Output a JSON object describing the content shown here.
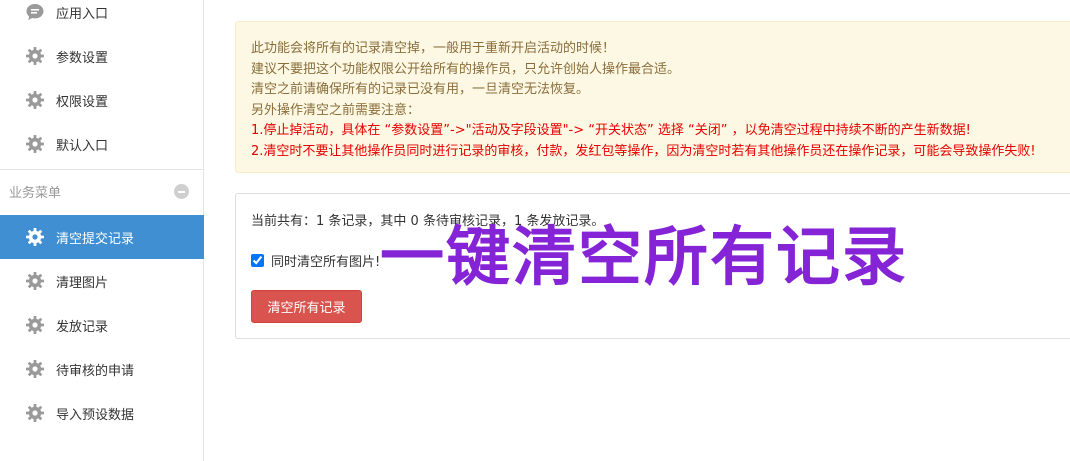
{
  "sidebar": {
    "items": [
      {
        "label": "应用入口",
        "icon": "chat-bubble-icon"
      },
      {
        "label": "参数设置",
        "icon": "gear-icon"
      },
      {
        "label": "权限设置",
        "icon": "gear-icon"
      },
      {
        "label": "默认入口",
        "icon": "gear-icon"
      }
    ],
    "section_label": "业务菜单",
    "business_items": [
      {
        "label": "清空提交记录",
        "icon": "gear-icon",
        "active": true
      },
      {
        "label": "清理图片",
        "icon": "gear-icon"
      },
      {
        "label": "发放记录",
        "icon": "gear-icon"
      },
      {
        "label": "待审核的申请",
        "icon": "gear-icon"
      },
      {
        "label": "导入预设数据",
        "icon": "gear-icon"
      }
    ]
  },
  "notice": {
    "lines": [
      "此功能会将所有的记录清空掉，一般用于重新开启活动的时候！",
      "建议不要把这个功能权限公开给所有的操作员，只允许创始人操作最合适。",
      "清空之前请确保所有的记录已没有用，一旦清空无法恢复。",
      "另外操作清空之前需要注意："
    ],
    "warnings": [
      "1.停止掉活动，具体在 “参数设置”->\"活动及字段设置\"-> “开关状态” 选择 “关闭” ，以免清空过程中持续不断的产生新数据!",
      "2.清空时不要让其他操作员同时进行记录的审核，付款，发红包等操作，因为清空时若有其他操作员还在操作记录，可能会导致操作失败!"
    ]
  },
  "panel": {
    "summary": "当前共有：1 条记录，其中 0 条待审核记录，1 条发放记录。",
    "checkbox_label": "同时清空所有图片!",
    "checkbox_checked": true,
    "button_label": "清空所有记录"
  },
  "overlay_title": "一键清空所有记录",
  "colors": {
    "active_bg": "#3f8fd2",
    "danger_btn": "#d9534f",
    "alert_bg": "#fcf8e3",
    "alert_text": "#8a6d3b",
    "warning_text": "#e60000",
    "overlay_text": "#8524d6"
  }
}
